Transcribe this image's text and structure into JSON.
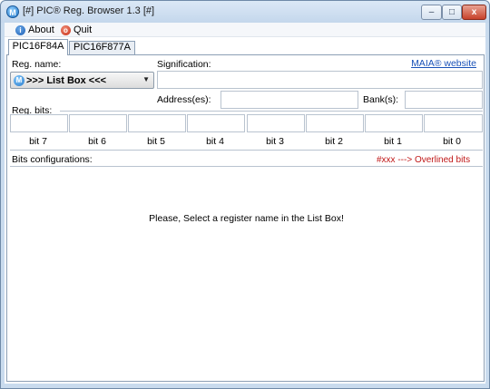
{
  "window": {
    "title": "[#] PIC® Reg. Browser 1.3 [#]",
    "app_icon_glyph": "M",
    "controls": {
      "minimize": "–",
      "maximize": "□",
      "close": "x"
    }
  },
  "menu": [
    {
      "label": "About",
      "icon": "info-icon"
    },
    {
      "label": "Quit",
      "icon": "stop-icon"
    }
  ],
  "tabs": [
    {
      "label": "PIC16F84A",
      "active": true
    },
    {
      "label": "PIC16F877A",
      "active": false
    }
  ],
  "form": {
    "reg_name_label": "Reg. name:",
    "signification_label": "Signification:",
    "website_link": "MAIA® website",
    "combo_value": ">>> List Box <<<",
    "combo_icon_glyph": "M",
    "address_label": "Address(es):",
    "bank_label": "Bank(s):",
    "reg_bits_label": "Reg. bits:"
  },
  "bits": [
    "bit 7",
    "bit 6",
    "bit 5",
    "bit 4",
    "bit 3",
    "bit 2",
    "bit 1",
    "bit 0"
  ],
  "bits_config": {
    "label": "Bits configurations:",
    "overline_note": "#xxx ---> Overlined bits",
    "message": "Please, Select a register name in the List Box!"
  },
  "colors": {
    "note": "#c01818",
    "link": "#1a52b8",
    "frame": "#c9dbee"
  }
}
